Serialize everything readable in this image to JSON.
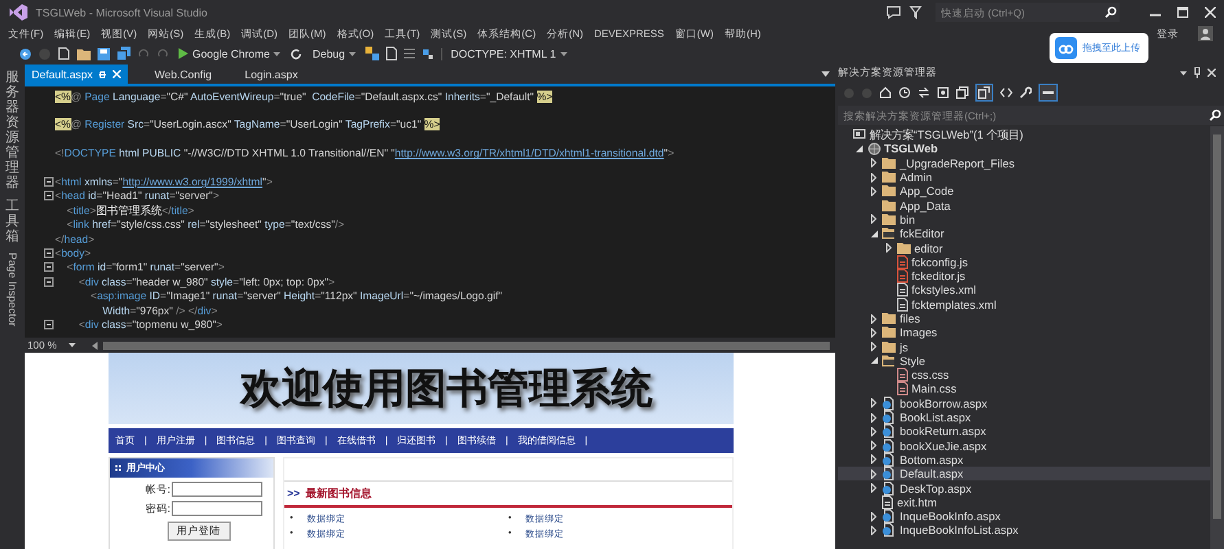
{
  "window": {
    "title": "TSGLWeb - Microsoft Visual Studio",
    "quick_launch": {
      "placeholder": "快速启动 (Ctrl+Q)"
    }
  },
  "menu": [
    "文件(F)",
    "编辑(E)",
    "视图(V)",
    "网站(S)",
    "生成(B)",
    "调试(D)",
    "团队(M)",
    "格式(O)",
    "工具(T)",
    "测试(S)",
    "体系结构(C)",
    "分析(N)",
    "DEVEXPRESS",
    "窗口(W)",
    "帮助(H)"
  ],
  "sign_in": "登录",
  "upload_widget": {
    "label": "拖拽至此上传"
  },
  "toolbar": {
    "browser": "Google Chrome",
    "configuration": "Debug",
    "doctype": "DOCTYPE: XHTML 1"
  },
  "side_tabs": [
    {
      "label": "服务器资源管理器",
      "kind": "cjk"
    },
    {
      "label": "工具箱",
      "kind": "cjk"
    },
    {
      "label": "Page Inspector",
      "kind": "latin"
    }
  ],
  "doc_tabs": [
    {
      "label": "Default.aspx",
      "selected": true
    },
    {
      "label": "Web.Config",
      "selected": false
    },
    {
      "label": "Login.aspx",
      "selected": false
    }
  ],
  "editor": {
    "zoom": "100 %",
    "lines": [
      {
        "fold": false,
        "tokens": [
          {
            "kind": "hl",
            "text": "<%"
          },
          {
            "kind": "punct",
            "text": "@ "
          },
          {
            "kind": "tag",
            "text": "Page "
          },
          {
            "kind": "attr",
            "text": "Language"
          },
          {
            "kind": "punct",
            "text": "="
          },
          {
            "kind": "value",
            "text": "\"C#\" "
          },
          {
            "kind": "attr",
            "text": "AutoEventWireup"
          },
          {
            "kind": "punct",
            "text": "="
          },
          {
            "kind": "value",
            "text": "\"true\"  "
          },
          {
            "kind": "attr",
            "text": "CodeFile"
          },
          {
            "kind": "punct",
            "text": "="
          },
          {
            "kind": "value",
            "text": "\"Default.aspx.cs\" "
          },
          {
            "kind": "attr",
            "text": "Inherits"
          },
          {
            "kind": "punct",
            "text": "="
          },
          {
            "kind": "value",
            "text": "\"_Default\" "
          },
          {
            "kind": "hl",
            "text": "%>"
          }
        ]
      },
      {
        "fold": false
      },
      {
        "fold": false,
        "tokens": [
          {
            "kind": "hl",
            "text": "<%"
          },
          {
            "kind": "punct",
            "text": "@ "
          },
          {
            "kind": "tag",
            "text": "Register "
          },
          {
            "kind": "attr",
            "text": "Src"
          },
          {
            "kind": "punct",
            "text": "="
          },
          {
            "kind": "value",
            "text": "\"UserLogin.ascx\" "
          },
          {
            "kind": "attr",
            "text": "TagName"
          },
          {
            "kind": "punct",
            "text": "="
          },
          {
            "kind": "value",
            "text": "\"UserLogin\" "
          },
          {
            "kind": "attr",
            "text": "TagPrefix"
          },
          {
            "kind": "punct",
            "text": "="
          },
          {
            "kind": "value",
            "text": "\"uc1\" "
          },
          {
            "kind": "hl",
            "text": "%>"
          }
        ]
      },
      {
        "fold": false
      },
      {
        "fold": false,
        "tokens": [
          {
            "kind": "punct",
            "text": "<!"
          },
          {
            "kind": "tag",
            "text": "DOCTYPE "
          },
          {
            "kind": "attr",
            "text": "html PUBLIC "
          },
          {
            "kind": "value",
            "text": "\"-//W3C//DTD XHTML 1.0 Transitional//EN\" \""
          },
          {
            "kind": "link",
            "text": "http://www.w3.org/TR/xhtml1/DTD/xhtml1-transitional.dtd"
          },
          {
            "kind": "value",
            "text": "\""
          },
          {
            "kind": "punct",
            "text": ">"
          }
        ]
      },
      {
        "fold": false
      },
      {
        "fold": true,
        "tokens": [
          {
            "kind": "punct",
            "text": "<"
          },
          {
            "kind": "tag",
            "text": "html "
          },
          {
            "kind": "attr",
            "text": "xmlns"
          },
          {
            "kind": "punct",
            "text": "="
          },
          {
            "kind": "value",
            "text": "\""
          },
          {
            "kind": "link",
            "text": "http://www.w3.org/1999/xhtml"
          },
          {
            "kind": "value",
            "text": "\""
          },
          {
            "kind": "punct",
            "text": ">"
          }
        ]
      },
      {
        "fold": true,
        "tokens": [
          {
            "kind": "punct",
            "text": "<"
          },
          {
            "kind": "tag",
            "text": "head "
          },
          {
            "kind": "attr",
            "text": "id"
          },
          {
            "kind": "punct",
            "text": "="
          },
          {
            "kind": "value",
            "text": "\"Head1\" "
          },
          {
            "kind": "attr",
            "text": "runat"
          },
          {
            "kind": "punct",
            "text": "="
          },
          {
            "kind": "value",
            "text": "\"server\""
          },
          {
            "kind": "punct",
            "text": ">"
          }
        ]
      },
      {
        "fold": false,
        "tokens": [
          {
            "kind": "punct",
            "text": "    <"
          },
          {
            "kind": "tag",
            "text": "title"
          },
          {
            "kind": "punct",
            "text": ">"
          },
          {
            "kind": "text",
            "text": "图书管理系统"
          },
          {
            "kind": "punct",
            "text": "</"
          },
          {
            "kind": "tag",
            "text": "title"
          },
          {
            "kind": "punct",
            "text": ">"
          }
        ]
      },
      {
        "fold": false,
        "tokens": [
          {
            "kind": "punct",
            "text": "    <"
          },
          {
            "kind": "tag",
            "text": "link "
          },
          {
            "kind": "attr",
            "text": "href"
          },
          {
            "kind": "punct",
            "text": "="
          },
          {
            "kind": "value",
            "text": "\"style/css.css\" "
          },
          {
            "kind": "attr",
            "text": "rel"
          },
          {
            "kind": "punct",
            "text": "="
          },
          {
            "kind": "value",
            "text": "\"stylesheet\" "
          },
          {
            "kind": "attr",
            "text": "type"
          },
          {
            "kind": "punct",
            "text": "="
          },
          {
            "kind": "value",
            "text": "\"text/css\""
          },
          {
            "kind": "punct",
            "text": "/>"
          }
        ]
      },
      {
        "fold": false,
        "tokens": [
          {
            "kind": "punct",
            "text": "</"
          },
          {
            "kind": "tag",
            "text": "head"
          },
          {
            "kind": "punct",
            "text": ">"
          }
        ]
      },
      {
        "fold": true,
        "tokens": [
          {
            "kind": "punct",
            "text": "<"
          },
          {
            "kind": "tag",
            "text": "body"
          },
          {
            "kind": "punct",
            "text": ">"
          }
        ]
      },
      {
        "fold": true,
        "tokens": [
          {
            "kind": "punct",
            "text": "    <"
          },
          {
            "kind": "tag",
            "text": "form "
          },
          {
            "kind": "attr",
            "text": "id"
          },
          {
            "kind": "punct",
            "text": "="
          },
          {
            "kind": "value",
            "text": "\"form1\" "
          },
          {
            "kind": "attr",
            "text": "runat"
          },
          {
            "kind": "punct",
            "text": "="
          },
          {
            "kind": "value",
            "text": "\"server\""
          },
          {
            "kind": "punct",
            "text": ">"
          }
        ]
      },
      {
        "fold": true,
        "tokens": [
          {
            "kind": "punct",
            "text": "        <"
          },
          {
            "kind": "tag",
            "text": "div "
          },
          {
            "kind": "attr",
            "text": "class"
          },
          {
            "kind": "punct",
            "text": "="
          },
          {
            "kind": "value",
            "text": "\"header w_980\" "
          },
          {
            "kind": "attr",
            "text": "style"
          },
          {
            "kind": "punct",
            "text": "="
          },
          {
            "kind": "value",
            "text": "\"left: 0px; top: 0px\""
          },
          {
            "kind": "punct",
            "text": ">"
          }
        ]
      },
      {
        "fold": false,
        "tokens": [
          {
            "kind": "punct",
            "text": "            <"
          },
          {
            "kind": "tag",
            "text": "asp:image "
          },
          {
            "kind": "attr",
            "text": "ID"
          },
          {
            "kind": "punct",
            "text": "="
          },
          {
            "kind": "value",
            "text": "\"Image1\" "
          },
          {
            "kind": "attr",
            "text": "runat"
          },
          {
            "kind": "punct",
            "text": "="
          },
          {
            "kind": "value",
            "text": "\"server\" "
          },
          {
            "kind": "attr",
            "text": "Height"
          },
          {
            "kind": "punct",
            "text": "="
          },
          {
            "kind": "value",
            "text": "\"112px\" "
          },
          {
            "kind": "attr",
            "text": "ImageUrl"
          },
          {
            "kind": "punct",
            "text": "="
          },
          {
            "kind": "value",
            "text": "\"~/images/Logo.gif\""
          }
        ]
      },
      {
        "fold": false,
        "tokens": [
          {
            "kind": "attr",
            "text": "                Width"
          },
          {
            "kind": "punct",
            "text": "="
          },
          {
            "kind": "value",
            "text": "\"976px\" "
          },
          {
            "kind": "punct",
            "text": "/> </"
          },
          {
            "kind": "tag",
            "text": "div"
          },
          {
            "kind": "punct",
            "text": ">"
          }
        ]
      },
      {
        "fold": true,
        "tokens": [
          {
            "kind": "punct",
            "text": "        <"
          },
          {
            "kind": "tag",
            "text": "div "
          },
          {
            "kind": "attr",
            "text": "class"
          },
          {
            "kind": "punct",
            "text": "="
          },
          {
            "kind": "value",
            "text": "\"topmenu w_980\""
          },
          {
            "kind": "punct",
            "text": ">"
          }
        ]
      }
    ]
  },
  "preview": {
    "banner": "欢迎使用图书管理系统",
    "separator": "|",
    "nav": [
      "首页",
      "用户注册",
      "图书信息",
      "图书查询",
      "在线借书",
      "归还图书",
      "图书续借",
      "我的借阅信息"
    ],
    "user_center": {
      "title": "用户中心",
      "fields": [
        {
          "label": "帐号:"
        },
        {
          "label": "密码:"
        }
      ],
      "button": "用户登陆"
    },
    "news": {
      "marker": ">>",
      "title": "最新图书信息",
      "bullet": "•",
      "items": [
        "数据绑定",
        "数据绑定",
        "数据绑定",
        "数据绑定"
      ]
    }
  },
  "solution_explorer": {
    "title": "解决方案资源管理器",
    "search": {
      "placeholder": "搜索解决方案资源管理器(Ctrl+;)"
    },
    "tree": [
      {
        "label": "解决方案“TSGLWeb”(1 个项目)",
        "kind": "solution",
        "selected": false,
        "children": [
          {
            "label": "TSGLWeb",
            "kind": "project",
            "expanded": true,
            "selected": false,
            "children": [
              {
                "label": "_UpgradeReport_Files",
                "kind": "folder",
                "expanded": false,
                "selected": false
              },
              {
                "label": "Admin",
                "kind": "folder",
                "expanded": false,
                "selected": false
              },
              {
                "label": "App_Code",
                "kind": "folder",
                "expanded": false,
                "selected": false
              },
              {
                "label": "App_Data",
                "kind": "folder",
                "selected": false
              },
              {
                "label": "bin",
                "kind": "folder",
                "expanded": false,
                "selected": false
              },
              {
                "label": "fckEditor",
                "kind": "folder",
                "expanded": true,
                "selected": false,
                "children": [
                  {
                    "label": "editor",
                    "kind": "folder",
                    "expanded": false,
                    "selected": false
                  },
                  {
                    "label": "fckconfig.js",
                    "kind": "js",
                    "selected": false
                  },
                  {
                    "label": "fckeditor.js",
                    "kind": "js",
                    "selected": false
                  },
                  {
                    "label": "fckstyles.xml",
                    "kind": "xml",
                    "selected": false
                  },
                  {
                    "label": "fcktemplates.xml",
                    "kind": "xml",
                    "selected": false
                  }
                ]
              },
              {
                "label": "files",
                "kind": "folder",
                "expanded": false,
                "selected": false
              },
              {
                "label": "Images",
                "kind": "folder",
                "expanded": false,
                "selected": false
              },
              {
                "label": "js",
                "kind": "folder",
                "expanded": false,
                "selected": false
              },
              {
                "label": "Style",
                "kind": "folder",
                "expanded": true,
                "selected": false,
                "children": [
                  {
                    "label": "css.css",
                    "kind": "css",
                    "selected": false
                  },
                  {
                    "label": "Main.css",
                    "kind": "css",
                    "selected": false
                  }
                ]
              },
              {
                "label": "bookBorrow.aspx",
                "kind": "aspx",
                "expanded": false,
                "selected": false
              },
              {
                "label": "BookList.aspx",
                "kind": "aspx",
                "expanded": false,
                "selected": false
              },
              {
                "label": "bookReturn.aspx",
                "kind": "aspx",
                "expanded": false,
                "selected": false
              },
              {
                "label": "bookXueJie.aspx",
                "kind": "aspx",
                "expanded": false,
                "selected": false
              },
              {
                "label": "Bottom.aspx",
                "kind": "aspx",
                "expanded": false,
                "selected": false
              },
              {
                "label": "Default.aspx",
                "kind": "aspx",
                "expanded": false,
                "selected": true
              },
              {
                "label": "DeskTop.aspx",
                "kind": "aspx",
                "expanded": false,
                "selected": false
              },
              {
                "label": "exit.htm",
                "kind": "htm",
                "selected": false
              },
              {
                "label": "InqueBookInfo.aspx",
                "kind": "aspx",
                "expanded": false,
                "selected": false
              },
              {
                "label": "InqueBookInfoList.aspx",
                "kind": "aspx",
                "expanded": false,
                "selected": false
              }
            ]
          }
        ]
      }
    ]
  }
}
